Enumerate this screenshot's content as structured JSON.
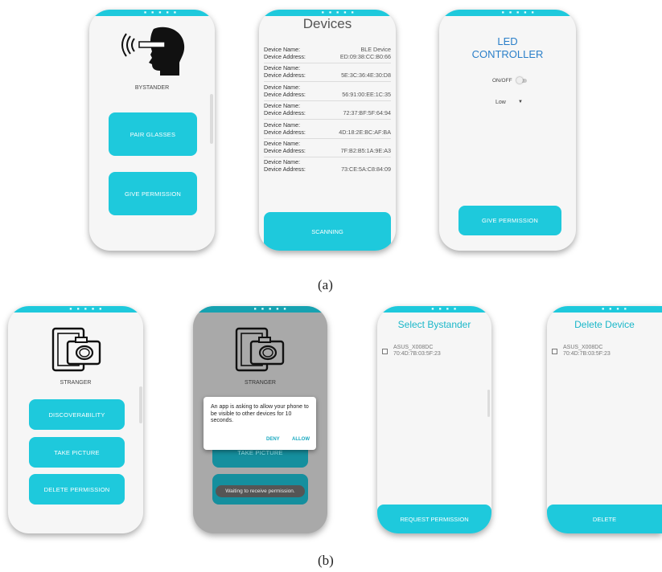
{
  "colors": {
    "accent": "#1ec9dc",
    "title_cyan": "#1ab7c9"
  },
  "captions": {
    "a": "(a)",
    "b": "(b)"
  },
  "bystander": {
    "icon": "head-with-glasses-icon",
    "label": "BYSTANDER",
    "buttons": [
      "PAIR GLASSES",
      "GIVE PERMISSION"
    ]
  },
  "devices": {
    "title": "Devices",
    "rows": [
      {
        "name_label": "Device Name:",
        "name_value": "BLE Device",
        "addr_label": "Device Address:",
        "addr_value": "ED:09:38:CC:B0:66"
      },
      {
        "name_label": "Device Name:",
        "name_value": "",
        "addr_label": "Device Address:",
        "addr_value": "5E:3C:36:4E:30:D8"
      },
      {
        "name_label": "Device Name:",
        "name_value": "",
        "addr_label": "Device Address:",
        "addr_value": "56:91:00:EE:1C:35"
      },
      {
        "name_label": "Device Name:",
        "name_value": "",
        "addr_label": "Device Address:",
        "addr_value": "72:37:BF:5F:64:94"
      },
      {
        "name_label": "Device Name:",
        "name_value": "",
        "addr_label": "Device Address:",
        "addr_value": "4D:18:2E:BC:AF:BA"
      },
      {
        "name_label": "Device Name:",
        "name_value": "",
        "addr_label": "Device Address:",
        "addr_value": "7F:B2:B5:1A:9E:A3"
      },
      {
        "name_label": "Device Name:",
        "name_value": "",
        "addr_label": "Device Address:",
        "addr_value": "73:CE:5A:C8:84:09"
      }
    ],
    "button": "SCANNING"
  },
  "led": {
    "title_line1": "LED",
    "title_line2": "CONTROLLER",
    "toggle_label": "ON/OFF",
    "select_value": "Low",
    "button": "GIVE PERMISSION"
  },
  "stranger": {
    "icon": "camera-frame-icon",
    "label": "STRANGER",
    "buttons": [
      "DISCOVERABILITY",
      "TAKE PICTURE",
      "DELETE PERMISSION"
    ]
  },
  "stranger_dialog": {
    "label": "STRANGER",
    "dialog_text": "An app is asking to allow your phone to be visible to other devices for 10 seconds.",
    "deny": "DENY",
    "allow": "ALLOW",
    "behind_button": "TAKE PICTURE",
    "toast": "Waiting to receive permission."
  },
  "select_bystander": {
    "title": "Select Bystander",
    "device_name": "ASUS_X008DC",
    "device_addr": "70:4D:7B:03:5F:23",
    "button": "REQUEST PERMISSION"
  },
  "delete_device": {
    "title": "Delete Device",
    "device_name": "ASUS_X008DC",
    "device_addr": "70:4D:7B:03:5F:23",
    "button": "DELETE"
  }
}
